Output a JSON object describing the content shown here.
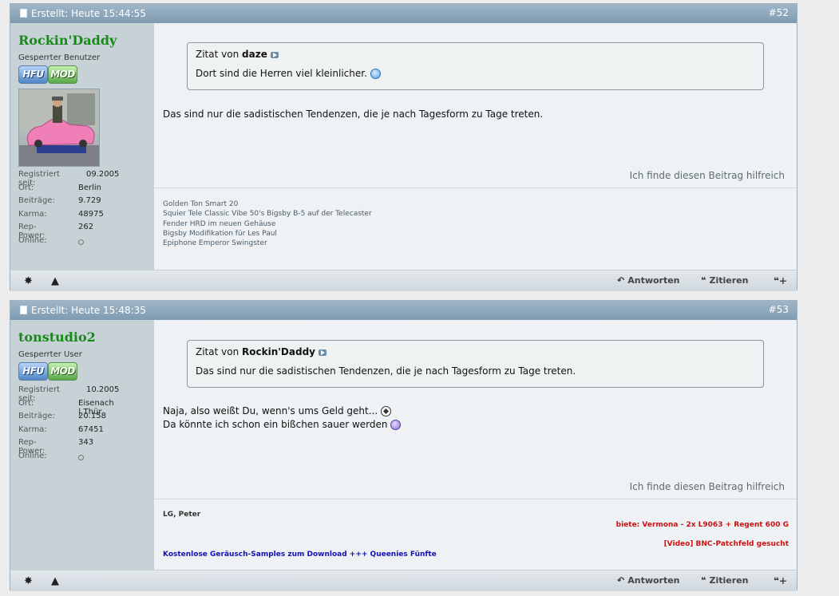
{
  "posts": [
    {
      "date": "Erstellt: Heute 15:44:55",
      "number": "#52",
      "user": {
        "name": "Rockin'Daddy",
        "title": "Gesperrter Benutzer",
        "badge1": "HFU",
        "badge2": "MOD",
        "stats": [
          {
            "label": "Registriert seit:",
            "value": "09.2005"
          },
          {
            "label": "Ort:",
            "value": "Berlin"
          },
          {
            "label": "Beiträge:",
            "value": "9.729"
          },
          {
            "label": "Karma:",
            "value": "48975"
          },
          {
            "label": "Rep-Power:",
            "value": "262"
          },
          {
            "label": "Online:",
            "value": ""
          }
        ]
      },
      "quote": {
        "prefix": "Zitat von",
        "author": "daze",
        "text": "Dort sind die Herren viel kleinlicher."
      },
      "message": [
        "Das sind nur die sadistischen Tendenzen, die je nach Tagesform zu Tage treten."
      ],
      "helpful": "Ich finde diesen Beitrag hilfreich",
      "signature": [
        "Golden Ton Smart 20",
        "Squier Tele Classic Vibe 50's Bigsby B-5 auf der Telecaster",
        "Fender HRD im neuen Gehäuse",
        "Bigsby Modifikation für Les Paul",
        "Epiphone Emperor Swingster"
      ]
    },
    {
      "date": "Erstellt: Heute 15:48:35",
      "number": "#53",
      "user": {
        "name": "tonstudio2",
        "title": "Gesperrter User",
        "badge1": "HFU",
        "badge2": "MOD",
        "stats": [
          {
            "label": "Registriert seit:",
            "value": "10.2005"
          },
          {
            "label": "Ort:",
            "value": "Eisenach | Thür"
          },
          {
            "label": "Beiträge:",
            "value": "20.158"
          },
          {
            "label": "Karma:",
            "value": "67451"
          },
          {
            "label": "Rep-Power:",
            "value": "343"
          },
          {
            "label": "Online:",
            "value": ""
          }
        ]
      },
      "quote": {
        "prefix": "Zitat von",
        "author": "Rockin'Daddy",
        "text": "Das sind nur die sadistischen Tendenzen, die je nach Tagesform zu Tage treten."
      },
      "message": [
        "Naja, also weißt Du, wenn's ums Geld geht...",
        "Da könnte ich schon ein bißchen sauer werden"
      ],
      "helpful": "Ich finde diesen Beitrag hilfreich",
      "signature": {
        "greeting": "LG, Peter",
        "offer": "biete: Vermona - 2x L9063 + Regent 600 G",
        "video": "[Video] BNC-Patchfeld gesucht",
        "link": "Kostenlose Geräusch-Samples zum Download +++ Queenies Fünfte"
      }
    }
  ],
  "footer": {
    "reply": "Antworten",
    "quote": "Zitieren"
  },
  "colors": {
    "username": "#178a17",
    "sig_red": "#cc1111",
    "sig_blue": "#1111bb"
  },
  "icons": [
    "document-icon",
    "star-icon",
    "warning-icon",
    "reply-arrow-icon",
    "quote-bubble-icon",
    "multiquote-plus-icon",
    "smiley-icon",
    "sad-smiley-icon",
    "soccer-ball-smiley-icon",
    "forward-arrow-icon"
  ]
}
